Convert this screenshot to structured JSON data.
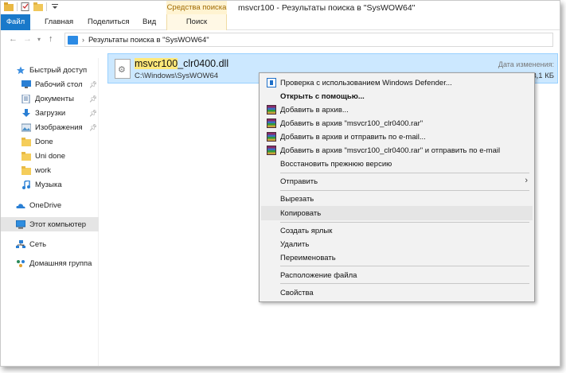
{
  "window": {
    "title": "msvcr100 - Результаты поиска в \"SysWOW64\"",
    "context_tab": "Средства поиска"
  },
  "ribbon": {
    "tabs": [
      "Файл",
      "Главная",
      "Поделиться",
      "Вид",
      "Поиск"
    ]
  },
  "address": {
    "path": "Результаты поиска в \"SysWOW64\""
  },
  "sidebar": {
    "items": [
      {
        "label": "Быстрый доступ",
        "icon": "star-icon"
      },
      {
        "label": "Рабочий стол",
        "icon": "desktop-icon",
        "pinned": true
      },
      {
        "label": "Документы",
        "icon": "documents-icon",
        "pinned": true
      },
      {
        "label": "Загрузки",
        "icon": "download-icon",
        "pinned": true
      },
      {
        "label": "Изображения",
        "icon": "pictures-icon",
        "pinned": true
      },
      {
        "label": "Done",
        "icon": "folder-icon"
      },
      {
        "label": "Uni done",
        "icon": "folder-icon"
      },
      {
        "label": "work",
        "icon": "folder-icon"
      },
      {
        "label": "Музыка",
        "icon": "music-icon"
      },
      {
        "label": "OneDrive",
        "icon": "cloud-icon"
      },
      {
        "label": "Этот компьютер",
        "icon": "computer-icon",
        "selected": true
      },
      {
        "label": "Сеть",
        "icon": "network-icon"
      },
      {
        "label": "Домашняя группа",
        "icon": "homegroup-icon"
      }
    ]
  },
  "result": {
    "name_highlight": "msvcr100",
    "name_rest": "_clr0400.dll",
    "path": "C:\\Windows\\SysWOW64",
    "date_label": "Дата изменения:",
    "size": "3,1 КБ"
  },
  "context_menu": {
    "items": [
      {
        "label": "Проверка с использованием Windows Defender...",
        "icon": "defender-icon"
      },
      {
        "label": "Открыть с помощью...",
        "bold": true
      },
      {
        "label": "Добавить в архив...",
        "icon": "winrar-icon"
      },
      {
        "label": "Добавить в архив \"msvcr100_clr0400.rar\"",
        "icon": "winrar-icon"
      },
      {
        "label": "Добавить в архив и отправить по e-mail...",
        "icon": "winrar-icon"
      },
      {
        "label": "Добавить в архив \"msvcr100_clr0400.rar\" и отправить по e-mail",
        "icon": "winrar-icon"
      },
      {
        "label": "Восстановить прежнюю версию"
      },
      {
        "label": "Отправить",
        "submenu": true
      },
      {
        "label": "Вырезать"
      },
      {
        "label": "Копировать",
        "hover": true
      },
      {
        "label": "Создать ярлык"
      },
      {
        "label": "Удалить"
      },
      {
        "label": "Переименовать"
      },
      {
        "label": "Расположение файла"
      },
      {
        "label": "Свойства"
      }
    ]
  },
  "colors": {
    "file_tab": "#1979ca",
    "selection": "#cce8ff",
    "highlight": "#ffe97a",
    "context_tab": "#fff3d1"
  }
}
